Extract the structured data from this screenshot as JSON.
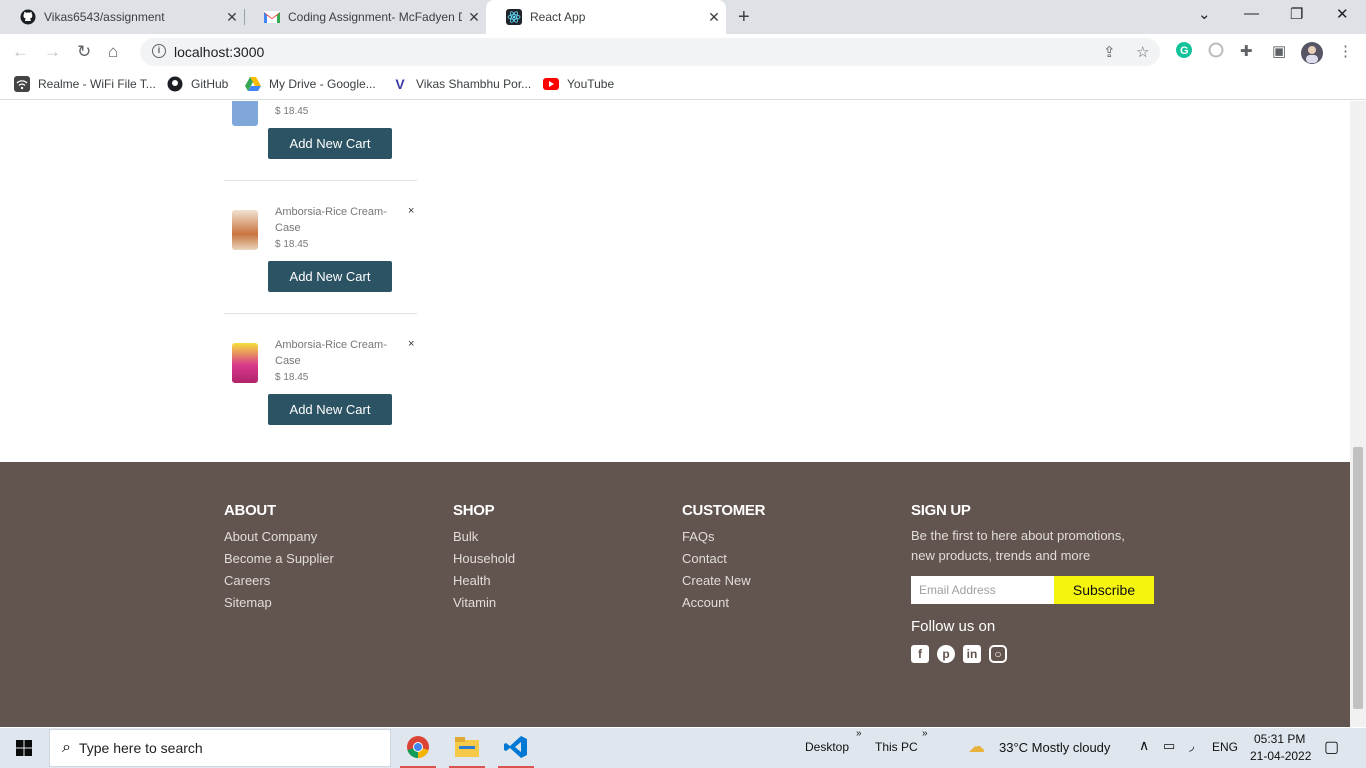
{
  "browser": {
    "tabs": [
      {
        "title": "Vikas6543/assignment",
        "icon": "github-icon"
      },
      {
        "title": "Coding Assignment- McFadyen D",
        "icon": "gmail-icon"
      },
      {
        "title": "React App",
        "icon": "react-icon"
      }
    ],
    "url": "localhost:3000",
    "bookmarks": [
      {
        "label": "Realme - WiFi File T...",
        "icon": "wifi-icon"
      },
      {
        "label": "GitHub",
        "icon": "github-icon"
      },
      {
        "label": "My Drive - Google...",
        "icon": "google-drive-icon"
      },
      {
        "label": "Vikas Shambhu Por...",
        "icon": "v-logo-icon"
      },
      {
        "label": "YouTube",
        "icon": "youtube-icon"
      }
    ]
  },
  "cart": {
    "items": [
      {
        "name": "",
        "price": "$ 18.45",
        "button": "Add New Cart"
      },
      {
        "name": "Amborsia-Rice Cream-Case",
        "price": "$ 18.45",
        "button": "Add New Cart",
        "remove": "×"
      },
      {
        "name": "Amborsia-Rice Cream-Case",
        "price": "$ 18.45",
        "button": "Add New Cart",
        "remove": "×"
      }
    ]
  },
  "footer": {
    "about": {
      "title": "ABOUT",
      "links": [
        "About Company",
        "Become a Supplier",
        "Careers",
        "Sitemap"
      ]
    },
    "shop": {
      "title": "SHOP",
      "links": [
        "Bulk",
        "Household",
        "Health",
        "Vitamin"
      ]
    },
    "customer": {
      "title": "CUSTOMER",
      "links": [
        "FAQs",
        "Contact",
        "Create New",
        "Account"
      ]
    },
    "signup": {
      "title": "SIGN UP",
      "text": "Be the first to here about promotions, new products, trends and more",
      "email_placeholder": "Email Address",
      "subscribe": "Subscribe",
      "follow": "Follow us on"
    },
    "social": [
      "facebook-icon",
      "pinterest-icon",
      "linkedin-icon",
      "instagram-icon"
    ]
  },
  "taskbar": {
    "search_placeholder": "Type here to search",
    "desktop": "Desktop",
    "thispc": "This PC",
    "weather": "33°C  Mostly cloudy",
    "lang": "ENG",
    "time": "05:31 PM",
    "date": "21-04-2022"
  },
  "colors": {
    "cart_button": "#2c5364",
    "footer_bg": "#62544e",
    "subscribe_bg": "#f4f40f"
  }
}
